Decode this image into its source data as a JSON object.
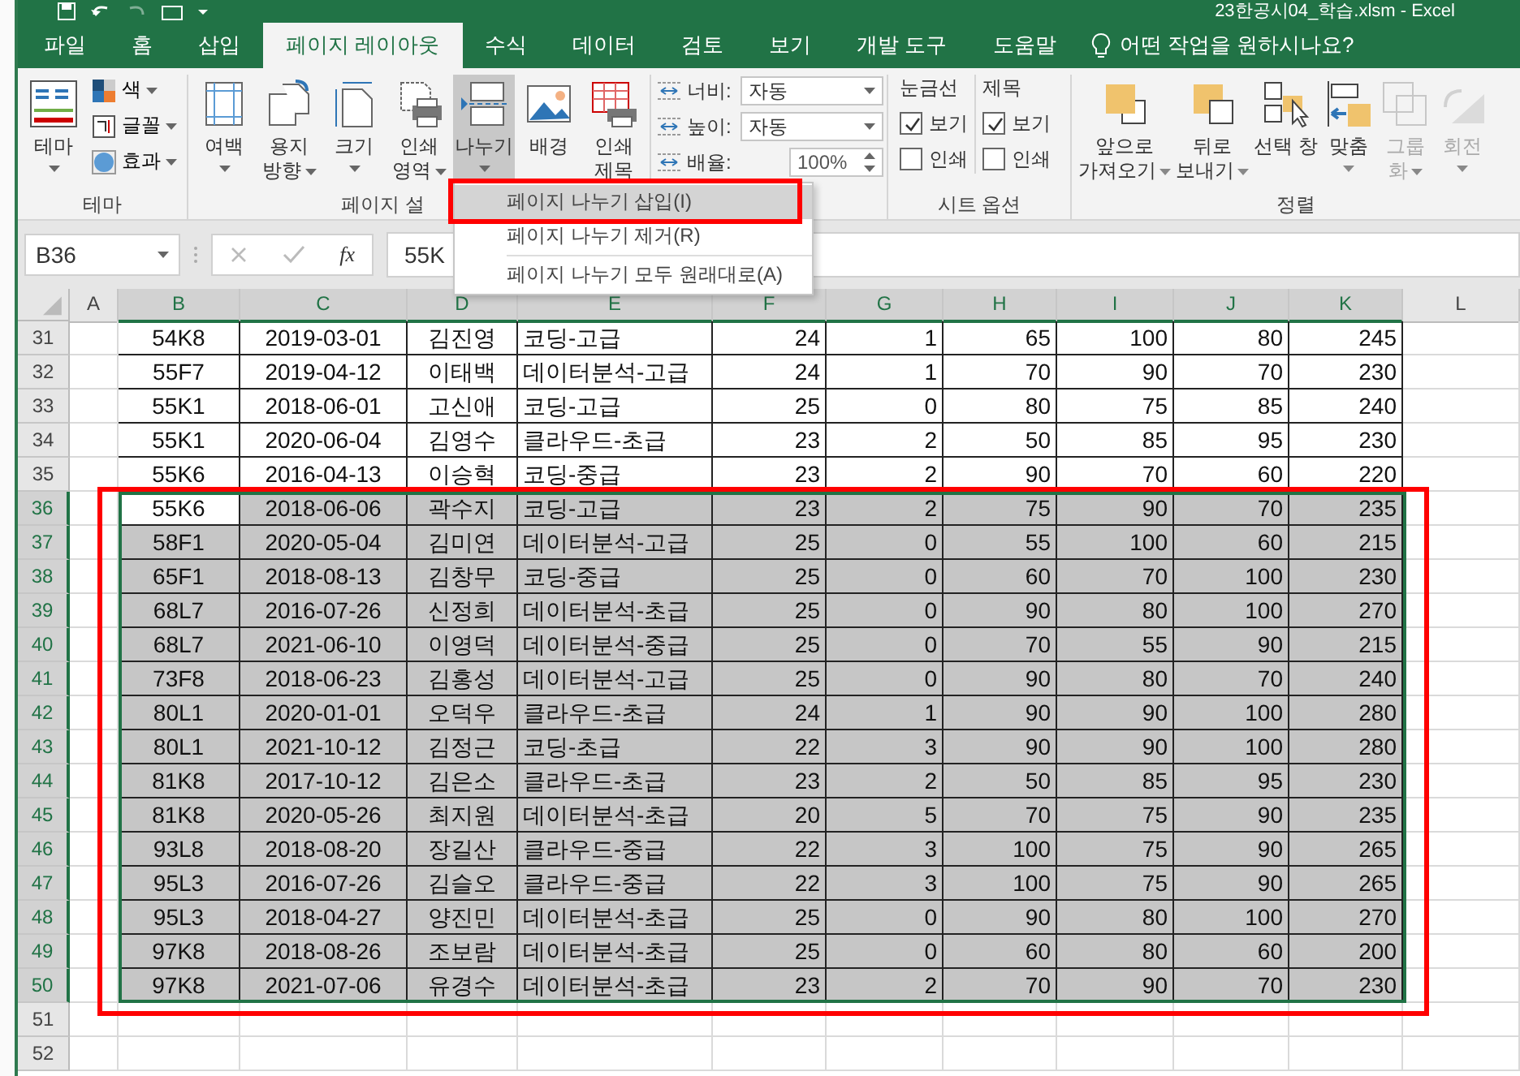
{
  "window": {
    "title": "23한공시04_학습.xlsm  -  Excel"
  },
  "tabs": [
    {
      "label": "파일",
      "selected": false
    },
    {
      "label": "홈",
      "selected": false
    },
    {
      "label": "삽입",
      "selected": false
    },
    {
      "label": "페이지 레이아웃",
      "selected": true
    },
    {
      "label": "수식",
      "selected": false
    },
    {
      "label": "데이터",
      "selected": false
    },
    {
      "label": "검토",
      "selected": false
    },
    {
      "label": "보기",
      "selected": false
    },
    {
      "label": "개발 도구",
      "selected": false
    },
    {
      "label": "도움말",
      "selected": false
    }
  ],
  "tell_me": {
    "placeholder": "어떤 작업을 원하시나요?"
  },
  "ribbon": {
    "theme_group": {
      "label": "테마",
      "theme_button": "테마",
      "options": [
        "색",
        "글꼴",
        "효과"
      ]
    },
    "page_setup_group": {
      "label": "페이지 설",
      "buttons": [
        {
          "lines": [
            "여백"
          ],
          "dropdown": true,
          "selected": false
        },
        {
          "lines": [
            "용지",
            "방향"
          ],
          "dropdown": true,
          "selected": false
        },
        {
          "lines": [
            "크기"
          ],
          "dropdown": true,
          "selected": false
        },
        {
          "lines": [
            "인쇄",
            "영역"
          ],
          "dropdown": true,
          "selected": false
        },
        {
          "lines": [
            "나누기"
          ],
          "dropdown": true,
          "selected": true
        },
        {
          "lines": [
            "배경"
          ],
          "dropdown": false,
          "selected": false
        },
        {
          "lines": [
            "인쇄",
            "제목"
          ],
          "dropdown": false,
          "selected": false
        }
      ]
    },
    "scale_group": {
      "rows": [
        {
          "label": "너비:",
          "value": "자동",
          "kind": "combo"
        },
        {
          "label": "높이:",
          "value": "자동",
          "kind": "combo"
        },
        {
          "label": "배율:",
          "value": "100%",
          "kind": "spin"
        }
      ]
    },
    "sheet_options_group": {
      "label": "시트 옵션",
      "columns": [
        {
          "heading": "눈금선",
          "options": [
            {
              "label": "보기",
              "checked": true
            },
            {
              "label": "인쇄",
              "checked": false
            }
          ]
        },
        {
          "heading": "제목",
          "options": [
            {
              "label": "보기",
              "checked": true
            },
            {
              "label": "인쇄",
              "checked": false
            }
          ]
        }
      ]
    },
    "arrange_group": {
      "label": "정렬",
      "buttons": [
        {
          "lines": [
            "앞으로",
            "가져오기"
          ],
          "dropdown": true,
          "disabled": false
        },
        {
          "lines": [
            "뒤로",
            "보내기"
          ],
          "dropdown": true,
          "disabled": false
        },
        {
          "lines": [
            "선택 창"
          ],
          "dropdown": false,
          "disabled": false
        },
        {
          "lines": [
            "맞춤"
          ],
          "dropdown": true,
          "disabled": false
        },
        {
          "lines": [
            "그룹",
            "화"
          ],
          "dropdown": true,
          "disabled": true
        },
        {
          "lines": [
            "회전"
          ],
          "dropdown": true,
          "disabled": true
        }
      ]
    }
  },
  "context_menu": {
    "items": [
      {
        "label": "페이지 나누기 삽입(I)",
        "selected": true
      },
      {
        "label": "페이지 나누기 제거(R)",
        "selected": false
      },
      {
        "label": "페이지 나누기 모두 원래대로(A)",
        "selected": false
      }
    ]
  },
  "formula_bar": {
    "name_box": "B36",
    "insert_function": "fx",
    "value": "55K"
  },
  "sheet": {
    "columns": [
      {
        "label": "A",
        "selected": false
      },
      {
        "label": "B",
        "selected": true
      },
      {
        "label": "C",
        "selected": true
      },
      {
        "label": "D",
        "selected": true
      },
      {
        "label": "E",
        "selected": true
      },
      {
        "label": "F",
        "selected": true
      },
      {
        "label": "G",
        "selected": true
      },
      {
        "label": "H",
        "selected": true
      },
      {
        "label": "I",
        "selected": true
      },
      {
        "label": "J",
        "selected": true
      },
      {
        "label": "K",
        "selected": true
      },
      {
        "label": "L",
        "selected": false
      }
    ],
    "rows": [
      {
        "header": "31",
        "selected": false,
        "cells": [
          "54K8",
          "2019-03-01",
          "김진영",
          "코딩-고급",
          "24",
          "1",
          "65",
          "100",
          "80",
          "245"
        ]
      },
      {
        "header": "32",
        "selected": false,
        "cells": [
          "55F7",
          "2019-04-12",
          "이태백",
          "데이터분석-고급",
          "24",
          "1",
          "70",
          "90",
          "70",
          "230"
        ]
      },
      {
        "header": "33",
        "selected": false,
        "cells": [
          "55K1",
          "2018-06-01",
          "고신애",
          "코딩-고급",
          "25",
          "0",
          "80",
          "75",
          "85",
          "240"
        ]
      },
      {
        "header": "34",
        "selected": false,
        "cells": [
          "55K1",
          "2020-06-04",
          "김영수",
          "클라우드-초급",
          "23",
          "2",
          "50",
          "85",
          "95",
          "230"
        ]
      },
      {
        "header": "35",
        "selected": false,
        "cells": [
          "55K6",
          "2016-04-13",
          "이승혁",
          "코딩-중급",
          "23",
          "2",
          "90",
          "70",
          "60",
          "220"
        ]
      },
      {
        "header": "36",
        "selected": true,
        "active": true,
        "cells": [
          "55K6",
          "2018-06-06",
          "곽수지",
          "코딩-고급",
          "23",
          "2",
          "75",
          "90",
          "70",
          "235"
        ]
      },
      {
        "header": "37",
        "selected": true,
        "cells": [
          "58F1",
          "2020-05-04",
          "김미연",
          "데이터분석-고급",
          "25",
          "0",
          "55",
          "100",
          "60",
          "215"
        ]
      },
      {
        "header": "38",
        "selected": true,
        "cells": [
          "65F1",
          "2018-08-13",
          "김창무",
          "코딩-중급",
          "25",
          "0",
          "60",
          "70",
          "100",
          "230"
        ]
      },
      {
        "header": "39",
        "selected": true,
        "cells": [
          "68L7",
          "2016-07-26",
          "신정희",
          "데이터분석-초급",
          "25",
          "0",
          "90",
          "80",
          "100",
          "270"
        ]
      },
      {
        "header": "40",
        "selected": true,
        "cells": [
          "68L7",
          "2021-06-10",
          "이영덕",
          "데이터분석-중급",
          "25",
          "0",
          "70",
          "55",
          "90",
          "215"
        ]
      },
      {
        "header": "41",
        "selected": true,
        "cells": [
          "73F8",
          "2018-06-23",
          "김홍성",
          "데이터분석-고급",
          "25",
          "0",
          "90",
          "80",
          "70",
          "240"
        ]
      },
      {
        "header": "42",
        "selected": true,
        "cells": [
          "80L1",
          "2020-01-01",
          "오덕우",
          "클라우드-초급",
          "24",
          "1",
          "90",
          "90",
          "100",
          "280"
        ]
      },
      {
        "header": "43",
        "selected": true,
        "cells": [
          "80L1",
          "2021-10-12",
          "김정근",
          "코딩-초급",
          "22",
          "3",
          "90",
          "90",
          "100",
          "280"
        ]
      },
      {
        "header": "44",
        "selected": true,
        "cells": [
          "81K8",
          "2017-10-12",
          "김은소",
          "클라우드-초급",
          "23",
          "2",
          "50",
          "85",
          "95",
          "230"
        ]
      },
      {
        "header": "45",
        "selected": true,
        "cells": [
          "81K8",
          "2020-05-26",
          "최지원",
          "데이터분석-초급",
          "20",
          "5",
          "70",
          "75",
          "90",
          "235"
        ]
      },
      {
        "header": "46",
        "selected": true,
        "cells": [
          "93L8",
          "2018-08-20",
          "장길산",
          "클라우드-중급",
          "22",
          "3",
          "100",
          "75",
          "90",
          "265"
        ]
      },
      {
        "header": "47",
        "selected": true,
        "cells": [
          "95L3",
          "2016-07-26",
          "김슬오",
          "클라우드-중급",
          "22",
          "3",
          "100",
          "75",
          "90",
          "265"
        ]
      },
      {
        "header": "48",
        "selected": true,
        "cells": [
          "95L3",
          "2018-04-27",
          "양진민",
          "데이터분석-초급",
          "25",
          "0",
          "90",
          "80",
          "100",
          "270"
        ]
      },
      {
        "header": "49",
        "selected": true,
        "cells": [
          "97K8",
          "2018-08-26",
          "조보람",
          "데이터분석-초급",
          "25",
          "0",
          "60",
          "80",
          "60",
          "200"
        ]
      },
      {
        "header": "50",
        "selected": true,
        "cells": [
          "97K8",
          "2021-07-06",
          "유경수",
          "데이터분석-초급",
          "23",
          "2",
          "70",
          "90",
          "70",
          "230"
        ]
      },
      {
        "header": "51",
        "selected": false
      },
      {
        "header": "52",
        "selected": false
      }
    ]
  }
}
